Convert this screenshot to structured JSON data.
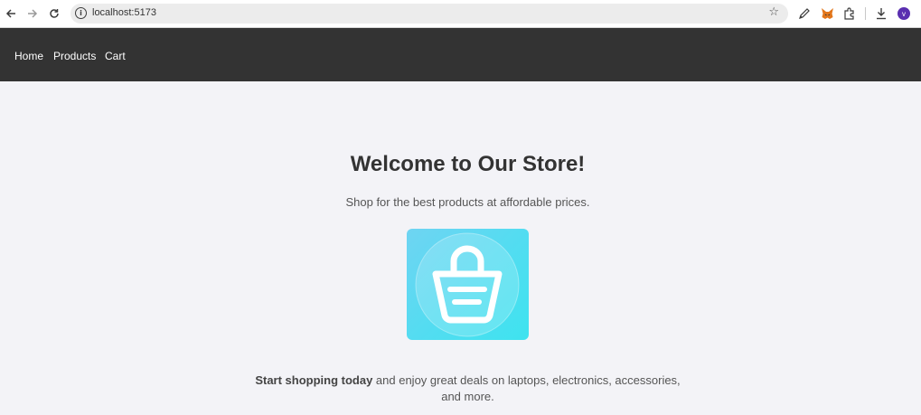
{
  "browser": {
    "url": "localhost:5173",
    "profile_initial": "v",
    "icons": {
      "back": "arrow-left-icon",
      "forward": "arrow-right-icon",
      "reload": "reload-icon",
      "site_info": "info-icon",
      "bookmark": "star-icon",
      "extension_1": "pen-icon",
      "extension_2": "metamask-fox-icon",
      "extensions": "puzzle-icon",
      "downloads": "download-icon"
    }
  },
  "nav": {
    "items": [
      {
        "label": "Home"
      },
      {
        "label": "Products"
      },
      {
        "label": "Cart"
      }
    ]
  },
  "hero": {
    "title": "Welcome to Our Store!",
    "subtitle": "Shop for the best products at affordable prices.",
    "image_icon": "shopping-basket-icon",
    "cta_bold": "Start shopping today",
    "cta_rest": " and enjoy great deals on laptops, electronics, accessories, and more."
  },
  "colors": {
    "nav_background": "#333333",
    "page_background": "#f3f3f7",
    "image_gradient_start": "#6fd4f2",
    "image_gradient_end": "#3ee3ef",
    "avatar": "#5a2fb0"
  }
}
